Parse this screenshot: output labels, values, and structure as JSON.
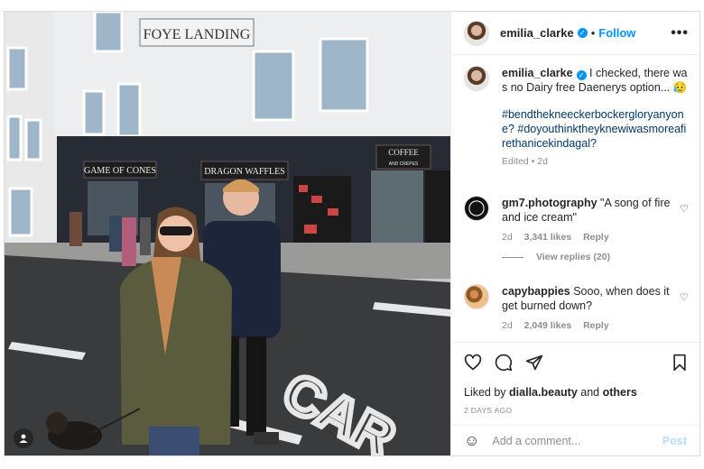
{
  "post": {
    "author": "emilia_clarke",
    "follow_label": "Follow",
    "more_label": "•••",
    "dot": "•"
  },
  "photo": {
    "sign_main": "FOYE LANDING",
    "sign_cones": "GAME OF CONES",
    "sign_waffles": "DRAGON WAFFLES",
    "sign_coffee": "COFFEE",
    "sign_crepes": "AND CREPES",
    "road_text": "CAR"
  },
  "caption": {
    "user": "emilia_clarke",
    "text": "I checked, there was no Dairy free Daenerys option... 😥",
    "hashtags": "#bendthekneeckerbockergloryanyone? #doyouthinktheyknewiwasmoreafirethanicekindagal?",
    "meta": "Edited • 2d"
  },
  "comments": [
    {
      "user": "gm7.photography",
      "text": "\"A song of fire and ice cream\"",
      "time": "2d",
      "likes": "3,341 likes",
      "reply": "Reply"
    },
    {
      "user": "capybappies",
      "text": "Sooo, when does it get burned down?",
      "time": "2d",
      "likes": "2,049 likes",
      "reply": "Reply"
    }
  ],
  "view_replies": "View replies (20)",
  "liked_by": {
    "prefix": "Liked by",
    "user": "dialla.beauty",
    "joiner": "and",
    "others": "others"
  },
  "time_ago": "2 DAYS AGO",
  "add_comment": {
    "placeholder": "Add a comment...",
    "post_label": "Post"
  },
  "colors": {
    "accent": "#0095f6",
    "link": "#00376b",
    "muted": "#8e8e8e"
  }
}
